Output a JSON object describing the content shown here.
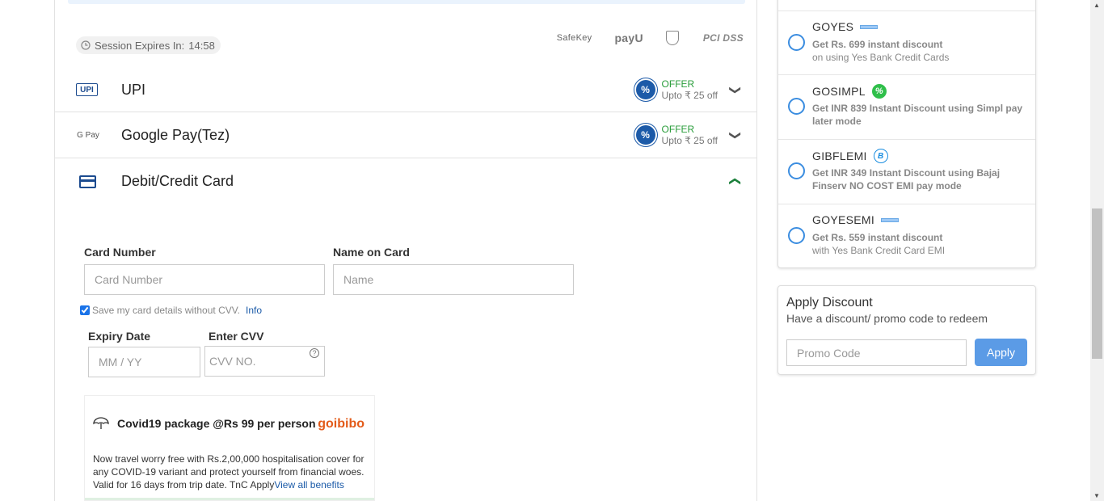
{
  "session": {
    "label": "Session Expires In:",
    "time": "14:58"
  },
  "trust_badges": {
    "safekey": "SafeKey",
    "payu": "payU",
    "security": "100% SECURITY GUARANTEE",
    "pci": "PCI DSS"
  },
  "payment_methods": [
    {
      "icon_text": "UPI",
      "title": "UPI",
      "offer_label": "OFFER",
      "offer_value": "Upto ₹ 25 off"
    },
    {
      "icon_text": "G Pay",
      "title": "Google Pay(Tez)",
      "offer_label": "OFFER",
      "offer_value": "Upto ₹ 25 off"
    },
    {
      "title": "Debit/Credit Card"
    }
  ],
  "card_form": {
    "card_number_label": "Card Number",
    "card_number_placeholder": "Card Number",
    "name_label": "Name on Card",
    "name_placeholder": "Name",
    "save_text": "Save my card details without CVV.",
    "info_link": "Info",
    "expiry_label": "Expiry Date",
    "expiry_placeholder": "MM / YY",
    "cvv_label": "Enter CVV",
    "cvv_placeholder": "CVV NO."
  },
  "covid": {
    "title": "Covid19 package @Rs 99 per person",
    "brand": "goibibo",
    "text": "Now travel worry free with Rs.2,00,000 hospitalisation cover for any COVID-19 variant and protect yourself from financial woes. Valid for 16 days from trip date. TnC Apply",
    "link": "View all benefits"
  },
  "offers": [
    {
      "code": "GOYES",
      "line1": "Get Rs. 699 instant discount",
      "line2": "on using Yes Bank Credit Cards"
    },
    {
      "code": "GOSIMPL",
      "line1": "Get INR 839 Instant Discount using Simpl pay later mode",
      "line2": ""
    },
    {
      "code": "GIBFLEMI",
      "line1": "Get INR 349 Instant Discount using Bajaj Finserv NO COST EMI pay mode",
      "line2": ""
    },
    {
      "code": "GOYESEMI",
      "line1": "Get Rs. 559 instant discount",
      "line2": "with Yes Bank Credit Card EMI"
    }
  ],
  "discount": {
    "title": "Apply Discount",
    "subtitle": "Have a discount/ promo code to redeem",
    "placeholder": "Promo Code",
    "button": "Apply"
  },
  "colors": {
    "accent": "#1c5aa8",
    "offer_green": "#2a9d3b",
    "apply_button": "#5b9be6"
  }
}
